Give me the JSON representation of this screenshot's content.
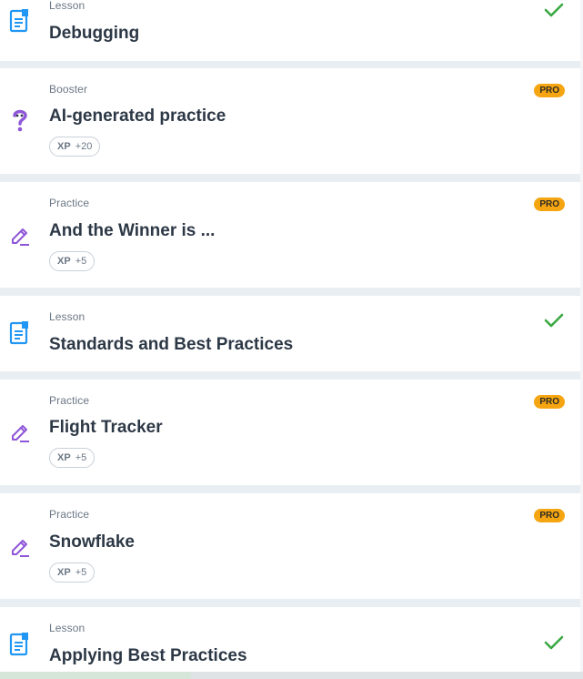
{
  "colors": {
    "lesson_icon": "#2196f3",
    "practice_icon": "#8e56d8",
    "pro_badge": "#f5a511",
    "check": "#3aa843"
  },
  "items": [
    {
      "type": "Lesson",
      "title": "Debugging",
      "icon": "document-icon",
      "completed": true
    },
    {
      "type": "Booster",
      "title": "AI-generated practice",
      "icon": "question-mark-icon",
      "pro": "PRO",
      "xp_label": "XP",
      "xp_value": "+20"
    },
    {
      "type": "Practice",
      "title": "And the Winner is ...",
      "icon": "pencil-icon",
      "pro": "PRO",
      "xp_label": "XP",
      "xp_value": "+5"
    },
    {
      "type": "Lesson",
      "title": "Standards and Best Practices",
      "icon": "document-icon",
      "completed": true
    },
    {
      "type": "Practice",
      "title": "Flight Tracker",
      "icon": "pencil-icon",
      "pro": "PRO",
      "xp_label": "XP",
      "xp_value": "+5"
    },
    {
      "type": "Practice",
      "title": "Snowflake",
      "icon": "pencil-icon",
      "pro": "PRO",
      "xp_label": "XP",
      "xp_value": "+5"
    },
    {
      "type": "Lesson",
      "title": "Applying Best Practices",
      "icon": "document-icon",
      "completed": true
    }
  ]
}
